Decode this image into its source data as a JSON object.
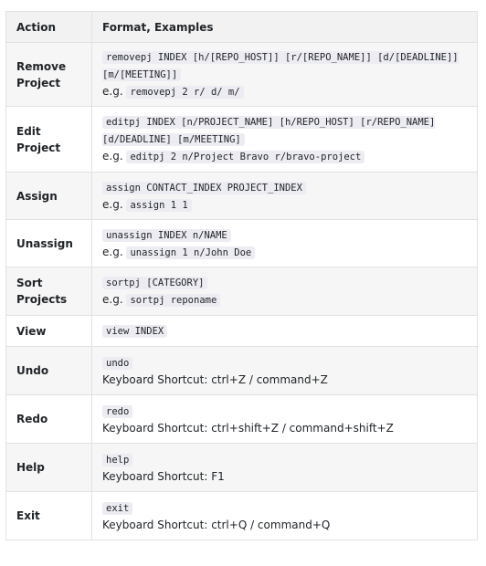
{
  "table": {
    "headers": [
      "Action",
      "Format, Examples"
    ],
    "rows": [
      {
        "action": "Remove Project",
        "format": "removepj INDEX [h/[REPO_HOST]] [r/[REPO_NAME]] [d/[DEADLINE]] [m/[MEETING]]",
        "example_prefix": "e.g.",
        "example": "removepj 2 r/ d/ m/"
      },
      {
        "action": "Edit Project",
        "format": "editpj INDEX [n/PROJECT_NAME] [h/REPO_HOST] [r/REPO_NAME] [d/DEADLINE] [m/MEETING]",
        "example_prefix": "e.g.",
        "example": "editpj 2 n/Project Bravo r/bravo-project"
      },
      {
        "action": "Assign",
        "format": "assign CONTACT_INDEX PROJECT_INDEX",
        "example_prefix": "e.g.",
        "example": "assign 1 1"
      },
      {
        "action": "Unassign",
        "format": "unassign INDEX n/NAME",
        "example_prefix": "e.g.",
        "example": "unassign 1 n/John Doe"
      },
      {
        "action": "Sort Projects",
        "format": "sortpj [CATEGORY]",
        "example_prefix": "e.g.",
        "example": "sortpj reponame"
      },
      {
        "action": "View",
        "format": "view INDEX"
      },
      {
        "action": "Undo",
        "format": "undo",
        "shortcut": "Keyboard Shortcut: ctrl+Z / command+Z"
      },
      {
        "action": "Redo",
        "format": "redo",
        "shortcut": "Keyboard Shortcut: ctrl+shift+Z / command+shift+Z"
      },
      {
        "action": "Help",
        "format": "help",
        "shortcut": "Keyboard Shortcut: F1"
      },
      {
        "action": "Exit",
        "format": "exit",
        "shortcut": "Keyboard Shortcut: ctrl+Q / command+Q"
      }
    ]
  }
}
